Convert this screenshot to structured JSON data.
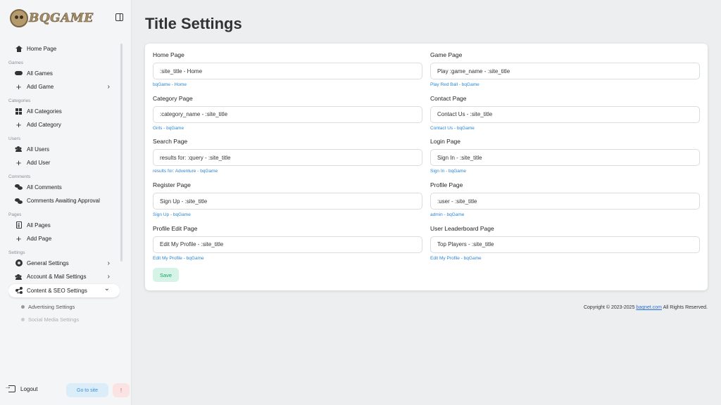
{
  "brand": {
    "name": "BQGAME"
  },
  "sidebar": {
    "items": [
      {
        "type": "item",
        "label": "Home Page",
        "icon": "home-icon"
      },
      {
        "type": "section",
        "label": "Games"
      },
      {
        "type": "item",
        "label": "All Games",
        "icon": "gamepad-icon"
      },
      {
        "type": "item",
        "label": "Add Game",
        "icon": "plus-icon",
        "chevron": "right"
      },
      {
        "type": "section",
        "label": "Categories"
      },
      {
        "type": "item",
        "label": "All Categories",
        "icon": "grid-icon"
      },
      {
        "type": "item",
        "label": "Add Category",
        "icon": "plus-icon"
      },
      {
        "type": "section",
        "label": "Users"
      },
      {
        "type": "item",
        "label": "All Users",
        "icon": "users-icon"
      },
      {
        "type": "item",
        "label": "Add User",
        "icon": "plus-icon"
      },
      {
        "type": "section",
        "label": "Comments"
      },
      {
        "type": "item",
        "label": "All Comments",
        "icon": "comments-icon"
      },
      {
        "type": "item",
        "label": "Comments Awaiting Approval",
        "icon": "comments-icon"
      },
      {
        "type": "section",
        "label": "Pages"
      },
      {
        "type": "item",
        "label": "All Pages",
        "icon": "document-icon"
      },
      {
        "type": "item",
        "label": "Add Page",
        "icon": "plus-icon"
      },
      {
        "type": "section",
        "label": "Settings"
      },
      {
        "type": "item",
        "label": "General Settings",
        "icon": "gear-icon",
        "chevron": "right"
      },
      {
        "type": "item",
        "label": "Account & Mail Settings",
        "icon": "users-icon",
        "chevron": "right"
      },
      {
        "type": "item",
        "label": "Content & SEO Settings",
        "icon": "share-icon",
        "chevron": "down",
        "active": true
      },
      {
        "type": "sub",
        "label": "Advertising Settings"
      },
      {
        "type": "sub",
        "label": "Social Media Settings",
        "faded": true
      }
    ],
    "logout_label": "Logout",
    "goto_site_label": "Go to site",
    "alert_label": "!"
  },
  "main": {
    "title": "Title Settings",
    "fields": [
      {
        "label": "Home Page",
        "value": ":site_title - Home",
        "hint": "bqGame - Home"
      },
      {
        "label": "Game Page",
        "value": "Play :game_name - :site_title",
        "hint": "Play Red Ball - bqGame"
      },
      {
        "label": "Category Page",
        "value": ":category_name - :site_title",
        "hint": "Girls - bqGame"
      },
      {
        "label": "Contact Page",
        "value": "Contact Us - :site_title",
        "hint": "Contact Us - bqGame"
      },
      {
        "label": "Search Page",
        "value": "results for: :query - :site_title",
        "hint": "results for: Adventure - bqGame"
      },
      {
        "label": "Login Page",
        "value": "Sign In - :site_title",
        "hint": "Sign In - bqGame"
      },
      {
        "label": "Register Page",
        "value": "Sign Up - :site_title",
        "hint": "Sign Up - bqGame"
      },
      {
        "label": "Profile Page",
        "value": ":user - :site_title",
        "hint": "admin - bqGame"
      },
      {
        "label": "Profile Edit Page",
        "value": "Edit My Profile - :site_title",
        "hint": "Edit My Profile - bqGame"
      },
      {
        "label": "User Leaderboard Page",
        "value": "Top Players - :site_title",
        "hint": "Edit My Profile - bqGame"
      }
    ],
    "save_label": "Save"
  },
  "footer": {
    "prefix": "Copyright © 2023-2025 ",
    "link": "baqnet.com",
    "suffix": " All Rights Reserved."
  },
  "colors": {
    "hint": "#2b86d6",
    "save_bg": "#d5f3e6",
    "save_text": "#1aa56a",
    "goto_bg": "#dcedfa",
    "alert_bg": "#fbe3e4"
  }
}
